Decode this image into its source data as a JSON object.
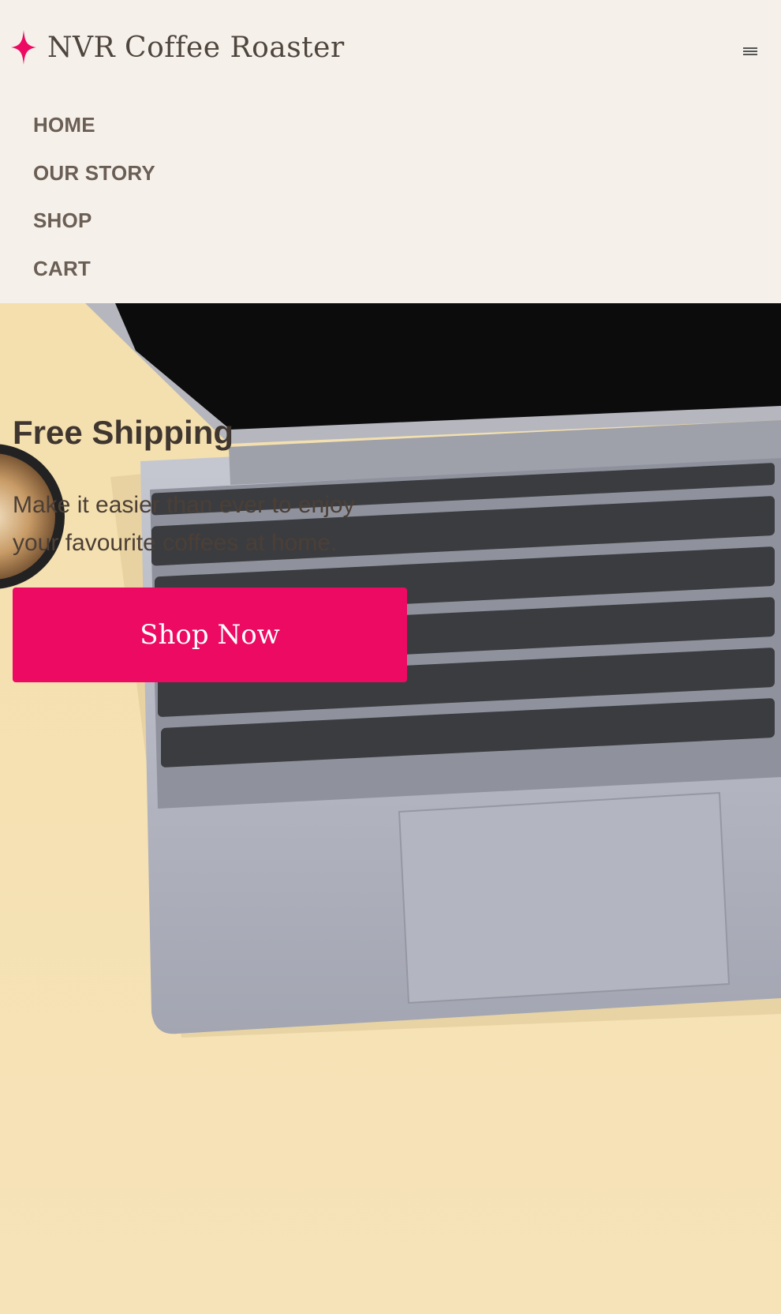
{
  "brand": {
    "name": "NVR Coffee Roaster",
    "accent_color": "#ed0a63",
    "logo_icon": "four-point-star-icon"
  },
  "header": {
    "menu_icon": "hamburger-menu-icon"
  },
  "nav": {
    "items": [
      {
        "label": "HOME"
      },
      {
        "label": "OUR STORY"
      },
      {
        "label": "SHOP"
      },
      {
        "label": "CART"
      }
    ]
  },
  "hero": {
    "title": "Free Shipping",
    "subtitle": "Make it easier than ever to enjoy your favourite coffees at home.",
    "cta_label": "Shop Now",
    "background_color": "#f4dfad",
    "image": "laptop-keyboard-and-coffee-cup-photo"
  }
}
